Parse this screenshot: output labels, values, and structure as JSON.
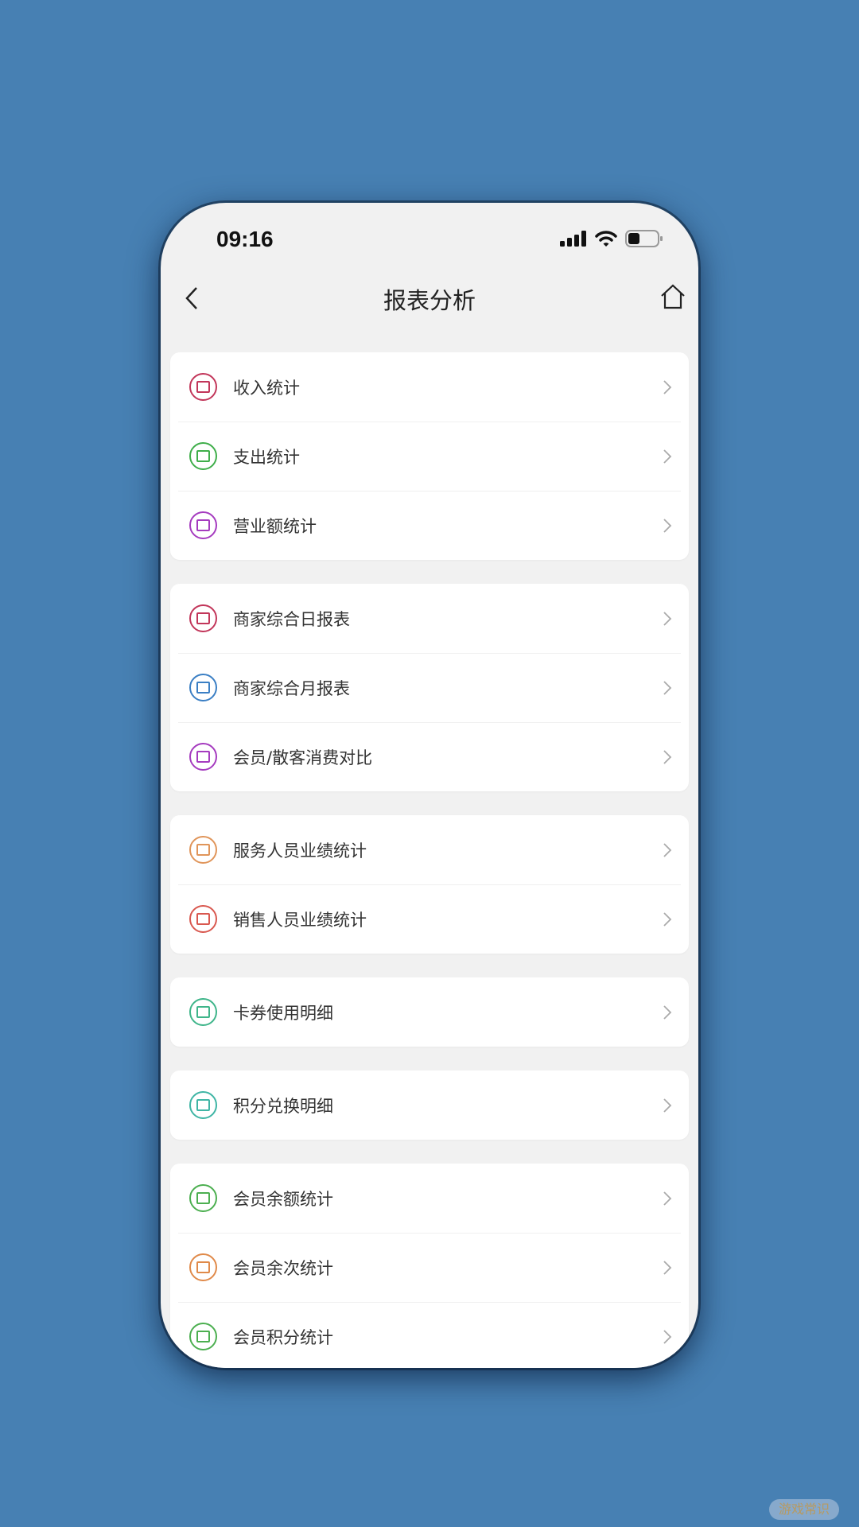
{
  "status_bar": {
    "time": "09:16",
    "icons": [
      "signal-icon",
      "wifi-icon",
      "battery-icon"
    ]
  },
  "nav": {
    "title": "报表分析",
    "back_icon": "chevron-left-icon",
    "home_icon": "home-icon"
  },
  "groups": [
    {
      "items": [
        {
          "label": "收入统计",
          "icon": "login-icon",
          "color": "#c2365a"
        },
        {
          "label": "支出统计",
          "icon": "logout-icon",
          "color": "#3fae4a"
        },
        {
          "label": "营业额统计",
          "icon": "trend-chart-icon",
          "color": "#a53bbf"
        }
      ]
    },
    {
      "items": [
        {
          "label": "商家综合日报表",
          "icon": "calendar-icon",
          "color": "#c2365a"
        },
        {
          "label": "商家综合月报表",
          "icon": "calendar-icon",
          "color": "#3b7fc4"
        },
        {
          "label": "会员/散客消费对比",
          "icon": "compare-icon",
          "color": "#a53bbf"
        }
      ]
    },
    {
      "items": [
        {
          "label": "服务人员业绩统计",
          "icon": "performance-icon",
          "color": "#e0955a"
        },
        {
          "label": "销售人员业绩统计",
          "icon": "performance-icon",
          "color": "#d9584f"
        }
      ]
    },
    {
      "items": [
        {
          "label": "卡券使用明细",
          "icon": "coupon-icon",
          "color": "#3fb58a"
        }
      ]
    },
    {
      "items": [
        {
          "label": "积分兑换明细",
          "icon": "coins-icon",
          "color": "#3fb5a5"
        }
      ]
    },
    {
      "items": [
        {
          "label": "会员余额统计",
          "icon": "wallet-icon",
          "color": "#4caf50"
        },
        {
          "label": "会员余次统计",
          "icon": "hourglass-icon",
          "color": "#e08a4a"
        },
        {
          "label": "会员积分统计",
          "icon": "coins-icon",
          "color": "#4caf50"
        }
      ]
    }
  ],
  "watermark": "游戏常识"
}
